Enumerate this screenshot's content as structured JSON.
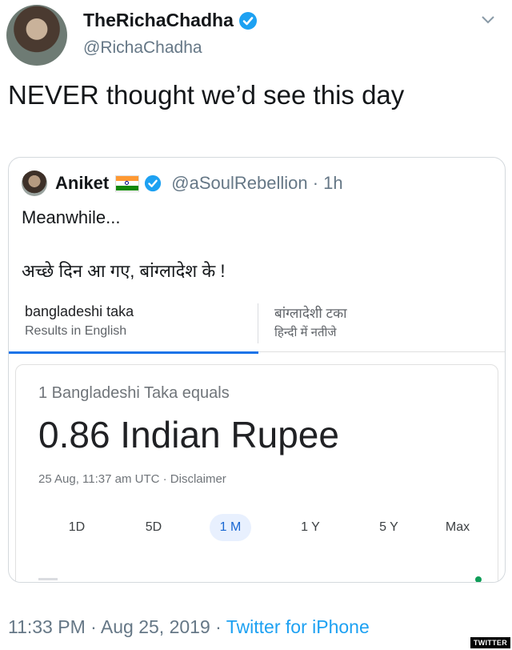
{
  "tweet": {
    "display_name": "TheRichaChadha",
    "handle": "@RichaChadha",
    "text": "NEVER thought we’d see this day",
    "timestamp": "11:33 PM · Aug 25, 2019 · ",
    "source": "Twitter for iPhone"
  },
  "quoted": {
    "name": "Aniket",
    "handle": "@aSoulRebellion · 1h",
    "line1": "Meanwhile...",
    "line2": "अच्छे दिन आ गए, बांग्लादेश के !"
  },
  "search_tabs": [
    {
      "title": "bangladeshi taka",
      "subtitle": "Results in English"
    },
    {
      "title": "बांग्लादेशी टका",
      "subtitle": "हिन्दी में नतीजे"
    }
  ],
  "converter": {
    "equals_text": "1 Bangladeshi Taka equals",
    "value_text": "0.86 Indian Rupee",
    "meta": "25 Aug, 11:37 am UTC · Disclaimer",
    "ranges": [
      "1D",
      "5D",
      "1 M",
      "1 Y",
      "5 Y",
      "Max"
    ],
    "active_range": "1 M"
  },
  "watermark": "TWITTER",
  "colors": {
    "verified": "#1da1f2",
    "accent": "#1a73e8",
    "source_link": "#1da1f2"
  }
}
